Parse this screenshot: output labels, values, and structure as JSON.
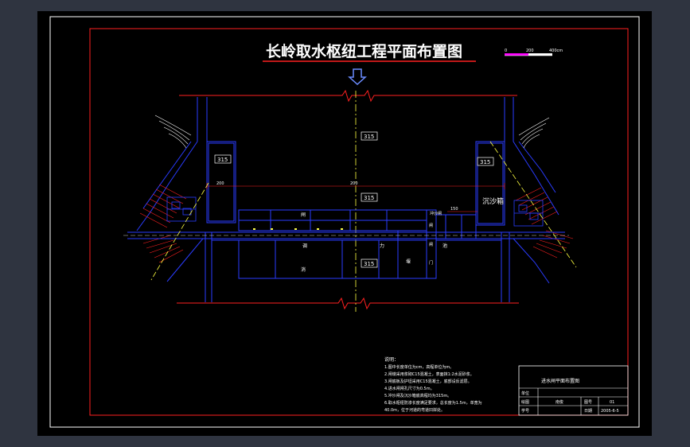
{
  "drawing": {
    "title": "长岭取水枢纽工程平面布置图",
    "scale_bar": {
      "labels": [
        "0",
        "200",
        "400cm"
      ]
    },
    "elevation_labels": [
      "315",
      "315",
      "315",
      "315",
      "315"
    ],
    "dim_labels": [
      "200",
      "200",
      "150"
    ],
    "sand_tank": "沉沙箱",
    "flush_label": "冲沙闸",
    "channel_chars": [
      "闸",
      "调",
      "力",
      "池"
    ],
    "lower_chars": [
      "消",
      "堰"
    ],
    "slot_markers": [
      "闸",
      "闸",
      "门"
    ],
    "notes": {
      "heading": "说明：",
      "lines": [
        "1.图中长度单位为cm，高程单位为m。",
        "2.闸墩采用浆砌C15混凝土，表面抹1:2水泥砂浆。",
        "3.闸底板及护坦采用C15混凝土，底部设反滤层。",
        "4.进水闸闸孔尺寸为0.5m。",
        "5.冲沙闸及沉沙箱底高程均为315m。",
        "6.取水枢纽防渗长度满足要求，总长度为1.5m，单宽为",
        "40.0m，位于河道的弯道凹岸处。"
      ]
    },
    "title_block": {
      "name": "进水闸平面布置图",
      "unit_label": "单位",
      "draw_label": "绘图",
      "draw_value": "南俊",
      "sheet_label": "图号",
      "sheet_value": "01",
      "student_label": "学号",
      "date_label": "日期",
      "date_value": "2005-6-5"
    }
  }
}
